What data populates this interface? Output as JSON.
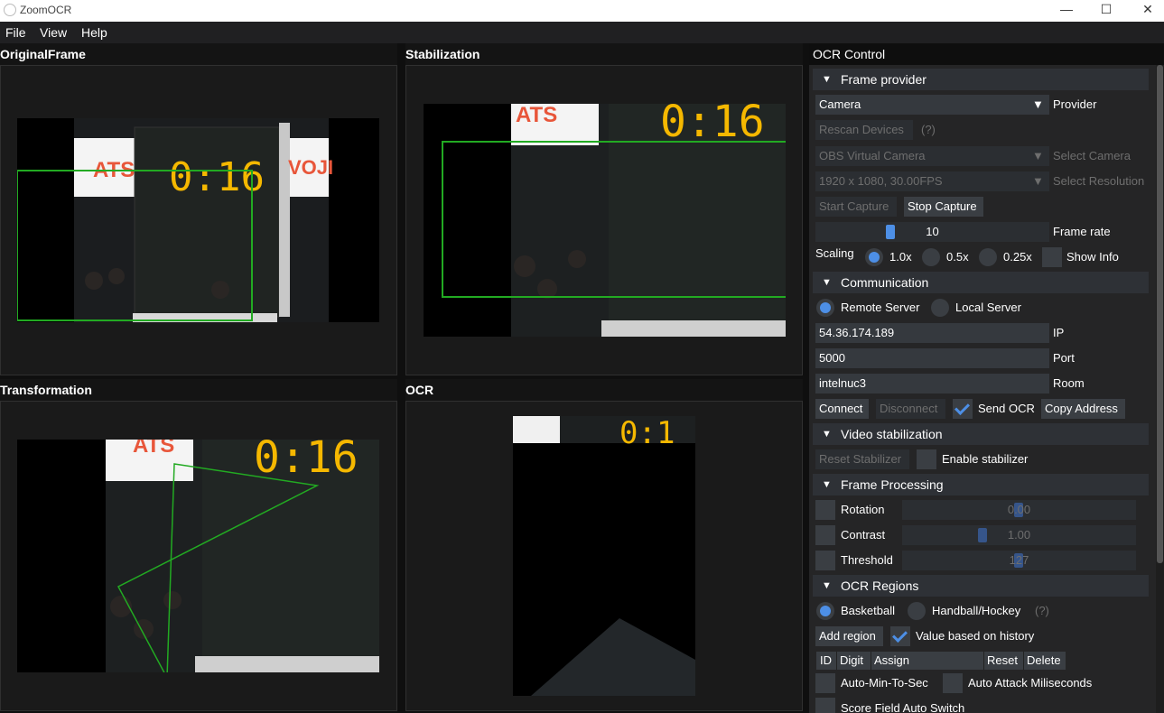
{
  "window": {
    "title": "ZoomOCR",
    "minimize": "—",
    "maximize": "☐",
    "close": "✕"
  },
  "menu": [
    "File",
    "View",
    "Help"
  ],
  "panels": {
    "original": "OriginalFrame",
    "stabilization": "Stabilization",
    "transformation": "Transformation",
    "ocr": "OCR"
  },
  "scene": {
    "sign_left": "ATS",
    "sign_right": "VOJI",
    "clock": "0:16"
  },
  "ocr_control": {
    "title": "OCR Control",
    "frame_provider": {
      "header": "Frame provider",
      "provider_value": "Camera",
      "provider_label": "Provider",
      "rescan": "Rescan Devices",
      "help": "(?)",
      "camera_value": "OBS Virtual Camera",
      "camera_label": "Select Camera",
      "resolution_value": "1920 x 1080, 30.00FPS",
      "resolution_label": "Select Resolution",
      "start": "Start Capture",
      "stop": "Stop Capture",
      "frame_rate_value": "10",
      "frame_rate_fraction": 0.32,
      "frame_rate_label": "Frame rate",
      "scaling_label": "Scaling",
      "scale_options": [
        "1.0x",
        "0.5x",
        "0.25x"
      ],
      "show_info": "Show Info"
    },
    "communication": {
      "header": "Communication",
      "remote": "Remote Server",
      "local": "Local Server",
      "ip_value": "54.36.174.189",
      "ip_label": "IP",
      "port_value": "5000",
      "port_label": "Port",
      "room_value": "intelnuc3",
      "room_label": "Room",
      "connect": "Connect",
      "disconnect": "Disconnect",
      "send_ocr": "Send OCR",
      "copy": "Copy Address"
    },
    "video_stabilization": {
      "header": "Video stabilization",
      "reset": "Reset Stabilizer",
      "enable": "Enable stabilizer"
    },
    "frame_processing": {
      "header": "Frame Processing",
      "rotation_label": "Rotation",
      "rotation_value": "0.00",
      "contrast_label": "Contrast",
      "contrast_value": "1.00",
      "threshold_label": "Threshold",
      "threshold_value": "127"
    },
    "ocr_regions": {
      "header": "OCR Regions",
      "basketball": "Basketball",
      "handball": "Handball/Hockey",
      "help": "(?)",
      "add_region": "Add region",
      "value_history": "Value based on history",
      "columns": [
        "ID",
        "Digit",
        "Assign",
        "Reset",
        "Delete"
      ],
      "auto_min": "Auto-Min-To-Sec",
      "auto_attack": "Auto Attack Miliseconds",
      "score_switch": "Score Field Auto Switch"
    }
  },
  "colors": {
    "accent": "#4d8fe6",
    "roi": "#22aa22",
    "digits": "#f5b800"
  }
}
